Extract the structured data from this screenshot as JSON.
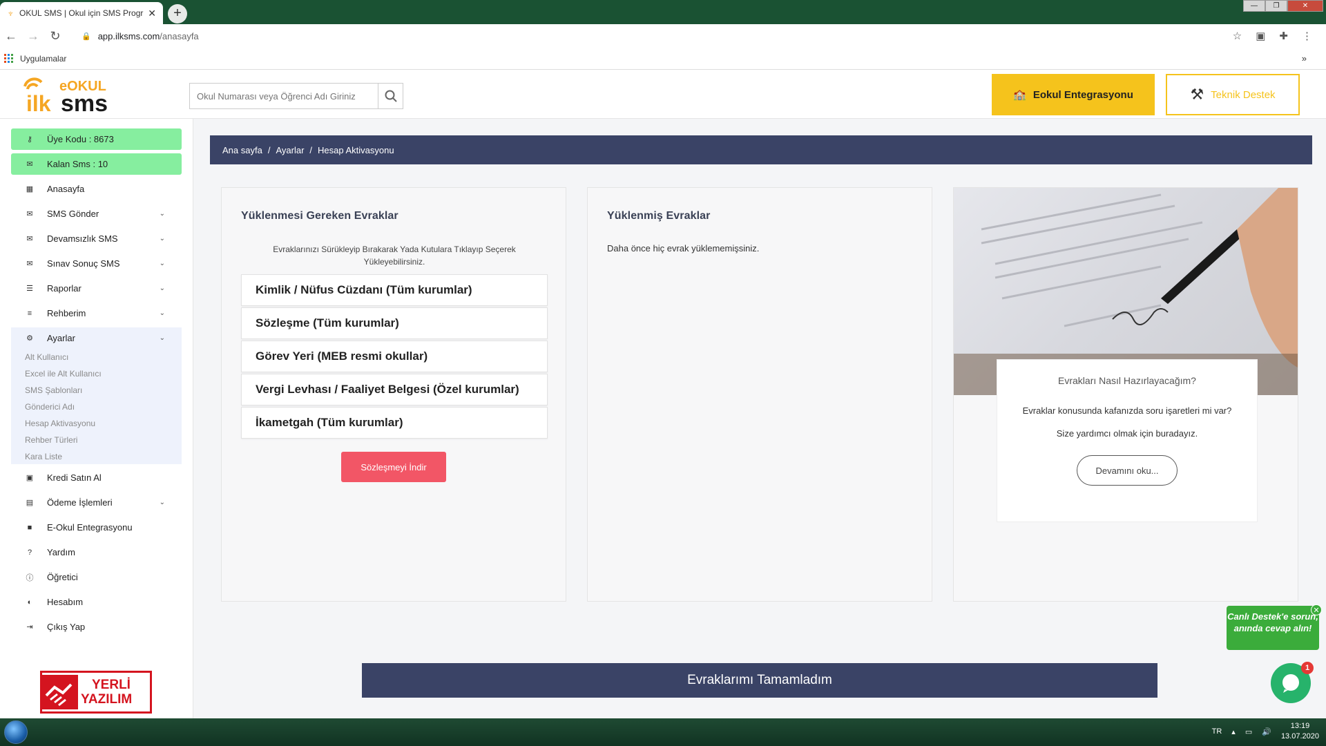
{
  "browser": {
    "tab_title": "OKUL SMS | Okul için SMS Progr",
    "url_domain": "app.ilksms.com",
    "url_path": "/anasayfa",
    "bookmarks_label": "Uygulamalar"
  },
  "header": {
    "logo_top": "eOKUL",
    "logo_main": "ilksms",
    "search_placeholder": "Okul Numarası veya Öğrenci Adı Giriniz",
    "eokul_label": "Eokul Entegrasyonu",
    "destek_label": "Teknik Destek"
  },
  "sidebar": {
    "member_code": "Üye Kodu : 8673",
    "remaining_sms": "Kalan Sms : 10",
    "items": [
      {
        "label": "Anasayfa"
      },
      {
        "label": "SMS Gönder"
      },
      {
        "label": "Devamsızlık SMS"
      },
      {
        "label": "Sınav Sonuç SMS"
      },
      {
        "label": "Raporlar"
      },
      {
        "label": "Rehberim"
      },
      {
        "label": "Ayarlar"
      },
      {
        "label": "Kredi Satın Al"
      },
      {
        "label": "Ödeme İşlemleri"
      },
      {
        "label": "E-Okul Entegrasyonu"
      },
      {
        "label": "Yardım"
      },
      {
        "label": "Öğretici"
      },
      {
        "label": "Hesabım"
      },
      {
        "label": "Çıkış Yap"
      }
    ],
    "sub_items": [
      "Alt Kullanıcı",
      "Excel ile Alt Kullanıcı",
      "SMS Şablonları",
      "Gönderici Adı",
      "Hesap Aktivasyonu",
      "Rehber Türleri",
      "Kara Liste"
    ],
    "badge_line1": "YERLİ",
    "badge_line2": "YAZILIM"
  },
  "breadcrumb": [
    "Ana sayfa",
    "/",
    "Ayarlar",
    "/",
    "Hesap Aktivasyonu"
  ],
  "required_docs": {
    "title": "Yüklenmesi Gereken Evraklar",
    "hint": "Evraklarınızı Sürükleyip Bırakarak Yada Kutulara Tıklayıp Seçerek Yükleyebilirsiniz.",
    "items": [
      "Kimlik / Nüfus Cüzdanı (Tüm kurumlar)",
      "Sözleşme (Tüm kurumlar)",
      "Görev Yeri (MEB resmi okullar)",
      "Vergi Levhası / Faaliyet Belgesi (Özel kurumlar)",
      "İkametgah (Tüm kurumlar)"
    ],
    "download_label": "Sözleşmeyi İndir"
  },
  "uploaded_docs": {
    "title": "Yüklenmiş Evraklar",
    "empty_text": "Daha önce hiç evrak yüklememişsiniz."
  },
  "help": {
    "title": "Evrakları Nasıl Hazırlayacağım?",
    "question": "Evraklar konusunda kafanızda soru işaretleri mi var?",
    "subtitle": "Size yardımcı olmak için buradayız.",
    "read_more": "Devamını oku..."
  },
  "complete_label": "Evraklarımı Tamamladım",
  "chat": {
    "bubble_text": "Canlı Destek'e sorun, anında cevap alın!",
    "badge": "1"
  },
  "taskbar": {
    "lang": "TR",
    "time": "13:19",
    "date": "13.07.2020"
  },
  "colors": {
    "navy": "#3a4366",
    "green_pill": "#86ee9f",
    "yellow": "#f5c31c",
    "red_button": "#f25666",
    "chat_green": "#3bac3b"
  }
}
